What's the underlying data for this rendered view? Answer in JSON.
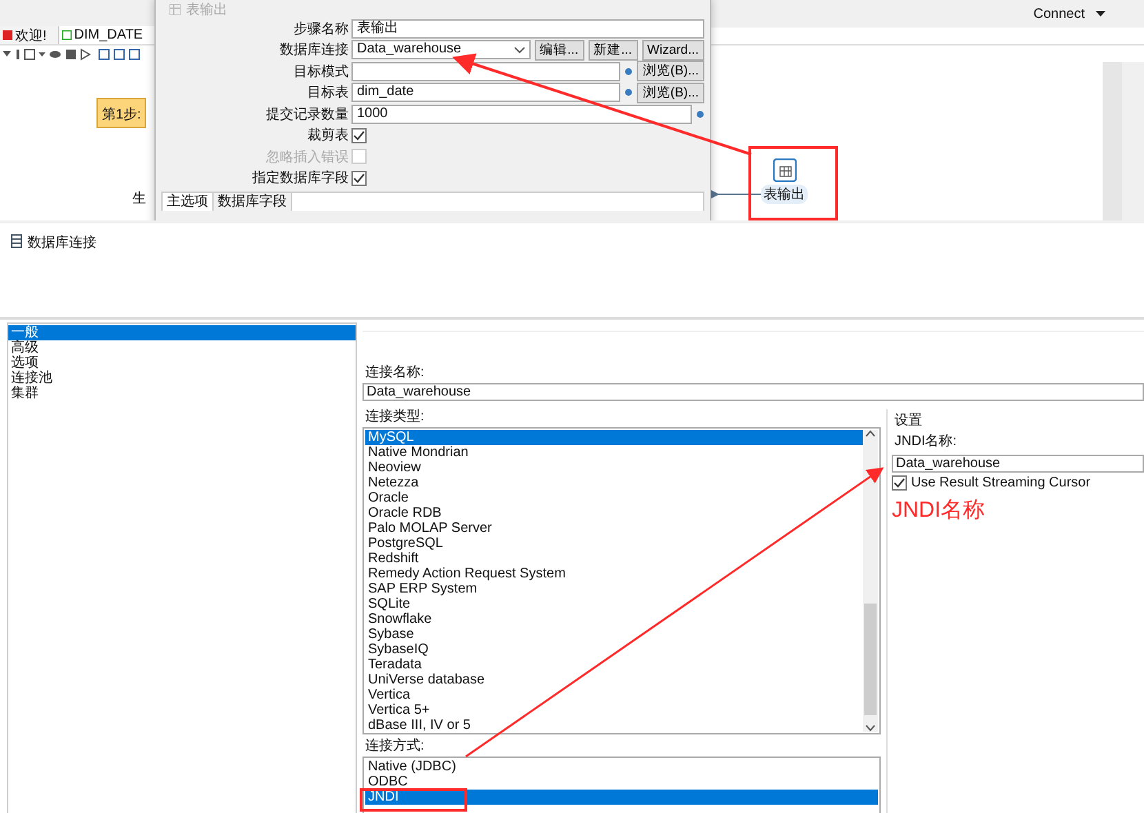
{
  "background_app": {
    "connect_menu": "Connect",
    "tabs": [
      {
        "label": "欢迎!",
        "selected": false
      },
      {
        "label": "DIM_DATE",
        "selected": true
      }
    ],
    "note": "第1步:",
    "partial_label": "生",
    "node": {
      "label": "表输出"
    }
  },
  "step_dialog": {
    "title": "表输出",
    "fields": [
      {
        "kind": "text",
        "label": "步骤名称",
        "value": "表输出"
      },
      {
        "kind": "select",
        "label": "数据库连接",
        "value": "Data_warehouse",
        "buttons": [
          "编辑...",
          "新建...",
          "Wizard..."
        ]
      },
      {
        "kind": "browse",
        "label": "目标模式",
        "button": "浏览(B)..."
      },
      {
        "kind": "browse",
        "label": "目标表",
        "value": "dim_date",
        "button": "浏览(B)..."
      },
      {
        "kind": "variable",
        "label": "提交记录数量",
        "value": "1000"
      },
      {
        "kind": "checkbox",
        "label": "裁剪表",
        "checked": true,
        "disabled": false
      },
      {
        "kind": "checkbox",
        "label": "忽略插入错误",
        "checked": false,
        "disabled": true
      },
      {
        "kind": "checkbox",
        "label": "指定数据库字段",
        "checked": true,
        "disabled": false
      }
    ],
    "tabs": [
      {
        "label": "主选项",
        "selected": true
      },
      {
        "label": "数据库字段",
        "selected": false
      }
    ]
  },
  "db_dialog": {
    "title": "数据库连接",
    "categories": [
      {
        "label": "一般",
        "selected": true
      },
      {
        "label": "高级",
        "selected": false
      },
      {
        "label": "选项",
        "selected": false
      },
      {
        "label": "连接池",
        "selected": false
      },
      {
        "label": "集群",
        "selected": false
      }
    ],
    "connection_name": {
      "label": "连接名称:",
      "value": "Data_warehouse"
    },
    "connection_type": {
      "label": "连接类型:",
      "items": [
        {
          "label": "MySQL",
          "selected": true
        },
        {
          "label": "Native Mondrian",
          "selected": false
        },
        {
          "label": "Neoview",
          "selected": false
        },
        {
          "label": "Netezza",
          "selected": false
        },
        {
          "label": "Oracle",
          "selected": false
        },
        {
          "label": "Oracle RDB",
          "selected": false
        },
        {
          "label": "Palo MOLAP Server",
          "selected": false
        },
        {
          "label": "PostgreSQL",
          "selected": false
        },
        {
          "label": "Redshift",
          "selected": false
        },
        {
          "label": "Remedy Action Request System",
          "selected": false
        },
        {
          "label": "SAP ERP System",
          "selected": false
        },
        {
          "label": "SQLite",
          "selected": false
        },
        {
          "label": "Snowflake",
          "selected": false
        },
        {
          "label": "Sybase",
          "selected": false
        },
        {
          "label": "SybaseIQ",
          "selected": false
        },
        {
          "label": "Teradata",
          "selected": false
        },
        {
          "label": "UniVerse database",
          "selected": false
        },
        {
          "label": "Vertica",
          "selected": false
        },
        {
          "label": "Vertica 5+",
          "selected": false
        },
        {
          "label": "dBase III, IV or 5",
          "selected": false
        }
      ]
    },
    "access": {
      "label": "连接方式:",
      "items": [
        {
          "label": "Native (JDBC)",
          "selected": false
        },
        {
          "label": "ODBC",
          "selected": false
        },
        {
          "label": "JNDI",
          "selected": true
        }
      ]
    },
    "settings": {
      "title": "设置",
      "jndi_label": "JNDI名称:",
      "jndi_value": "Data_warehouse",
      "streaming_cursor": {
        "label": "Use Result Streaming Cursor",
        "checked": true
      }
    }
  },
  "annotation": {
    "text": "JNDI名称"
  }
}
